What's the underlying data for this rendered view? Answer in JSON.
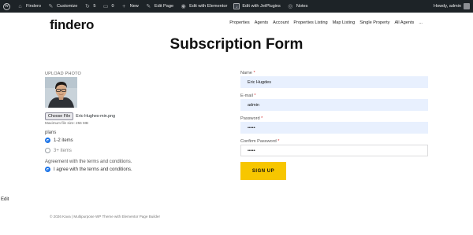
{
  "adminbar": {
    "site_name": "Findero",
    "customize": "Customize",
    "updates_count": "5",
    "comments_count": "0",
    "new_label": "New",
    "edit_page": "Edit Page",
    "edit_elementor": "Edit with Elementor",
    "edit_jetplugins": "Edit with JetPlugins",
    "notes": "Notes",
    "howdy": "Howdy, admin"
  },
  "header": {
    "logo": "findero",
    "nav": [
      "Properties",
      "Agents",
      "Account",
      "Properties Listing",
      "Map Listing",
      "Single Property",
      "All Agents",
      "..."
    ]
  },
  "page_title": "Subscription Form",
  "upload": {
    "label": "UPLOAD PHOTO",
    "choose_file_label": "Choose File",
    "file_name": "Eric-Hughes-min.png",
    "max_size": "Maximum file size: 256 MB"
  },
  "plans": {
    "label": "plans",
    "options": [
      {
        "label": "1-2 items",
        "selected": true
      },
      {
        "label": "3+ items",
        "selected": false
      }
    ]
  },
  "agreement": {
    "label": "Agreement with the terms and conditions.",
    "option": "I agree with the terms and conditions.",
    "checked": true
  },
  "form": {
    "name_label": "Name",
    "name_value": "Eric Hugdes",
    "email_label": "E-mail",
    "email_value": "admin",
    "password_label": "Password",
    "password_value": "•••••",
    "confirm_label": "Confirm Password",
    "confirm_value": "•••••",
    "required_mark": "*",
    "submit_label": "SIGN UP"
  },
  "edit_link": "Edit",
  "footer": "© 2026 Kava | Multipurpose WP Theme with Elementor Page Builder",
  "colors": {
    "adminbar_bg": "#1d2327",
    "field_bg": "#e8f0fe",
    "button_bg": "#f7c600",
    "radio_accent": "#1a73e8"
  }
}
